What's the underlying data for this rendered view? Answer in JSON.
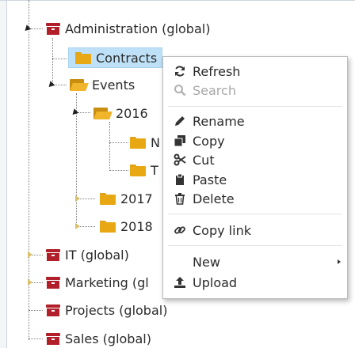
{
  "tree": {
    "nodes": [
      {
        "id": "administration",
        "label": "Administration (global)",
        "icon": "archive-icon"
      },
      {
        "id": "contracts",
        "label": "Contracts",
        "icon": "folder-icon",
        "selected": true
      },
      {
        "id": "events",
        "label": "Events",
        "icon": "folder-open-icon"
      },
      {
        "id": "2016",
        "label": "2016",
        "icon": "folder-open-icon"
      },
      {
        "id": "2016-child-1",
        "label": "N",
        "icon": "folder-icon"
      },
      {
        "id": "2016-child-2",
        "label": "T",
        "icon": "folder-icon"
      },
      {
        "id": "2017",
        "label": "2017",
        "icon": "folder-icon"
      },
      {
        "id": "2018",
        "label": "2018",
        "icon": "folder-icon"
      },
      {
        "id": "it",
        "label": "IT (global)",
        "icon": "archive-icon"
      },
      {
        "id": "marketing",
        "label": "Marketing (gl",
        "icon": "archive-icon"
      },
      {
        "id": "projects",
        "label": "Projects (global)",
        "icon": "archive-icon"
      },
      {
        "id": "sales",
        "label": "Sales (global)",
        "icon": "archive-icon"
      }
    ]
  },
  "context_menu": {
    "items": [
      {
        "label": "Refresh",
        "icon": "refresh-icon",
        "disabled": false
      },
      {
        "label": "Search",
        "icon": "search-icon",
        "disabled": true
      },
      {
        "label": "Rename",
        "icon": "pencil-icon",
        "disabled": false
      },
      {
        "label": "Copy",
        "icon": "copy-icon",
        "disabled": false
      },
      {
        "label": "Cut",
        "icon": "scissors-icon",
        "disabled": false
      },
      {
        "label": "Paste",
        "icon": "clipboard-icon",
        "disabled": false
      },
      {
        "label": "Delete",
        "icon": "trash-icon",
        "disabled": false
      },
      {
        "label": "Copy link",
        "icon": "link-icon",
        "disabled": false
      },
      {
        "label": "New",
        "icon": "",
        "disabled": false,
        "has_submenu": true
      },
      {
        "label": "Upload",
        "icon": "upload-icon",
        "disabled": false
      }
    ]
  },
  "colors": {
    "archive": "#b11f2b",
    "folder": "#e8a814",
    "selection": "#bfe1f7",
    "disabled_text": "#a8a8a8"
  }
}
